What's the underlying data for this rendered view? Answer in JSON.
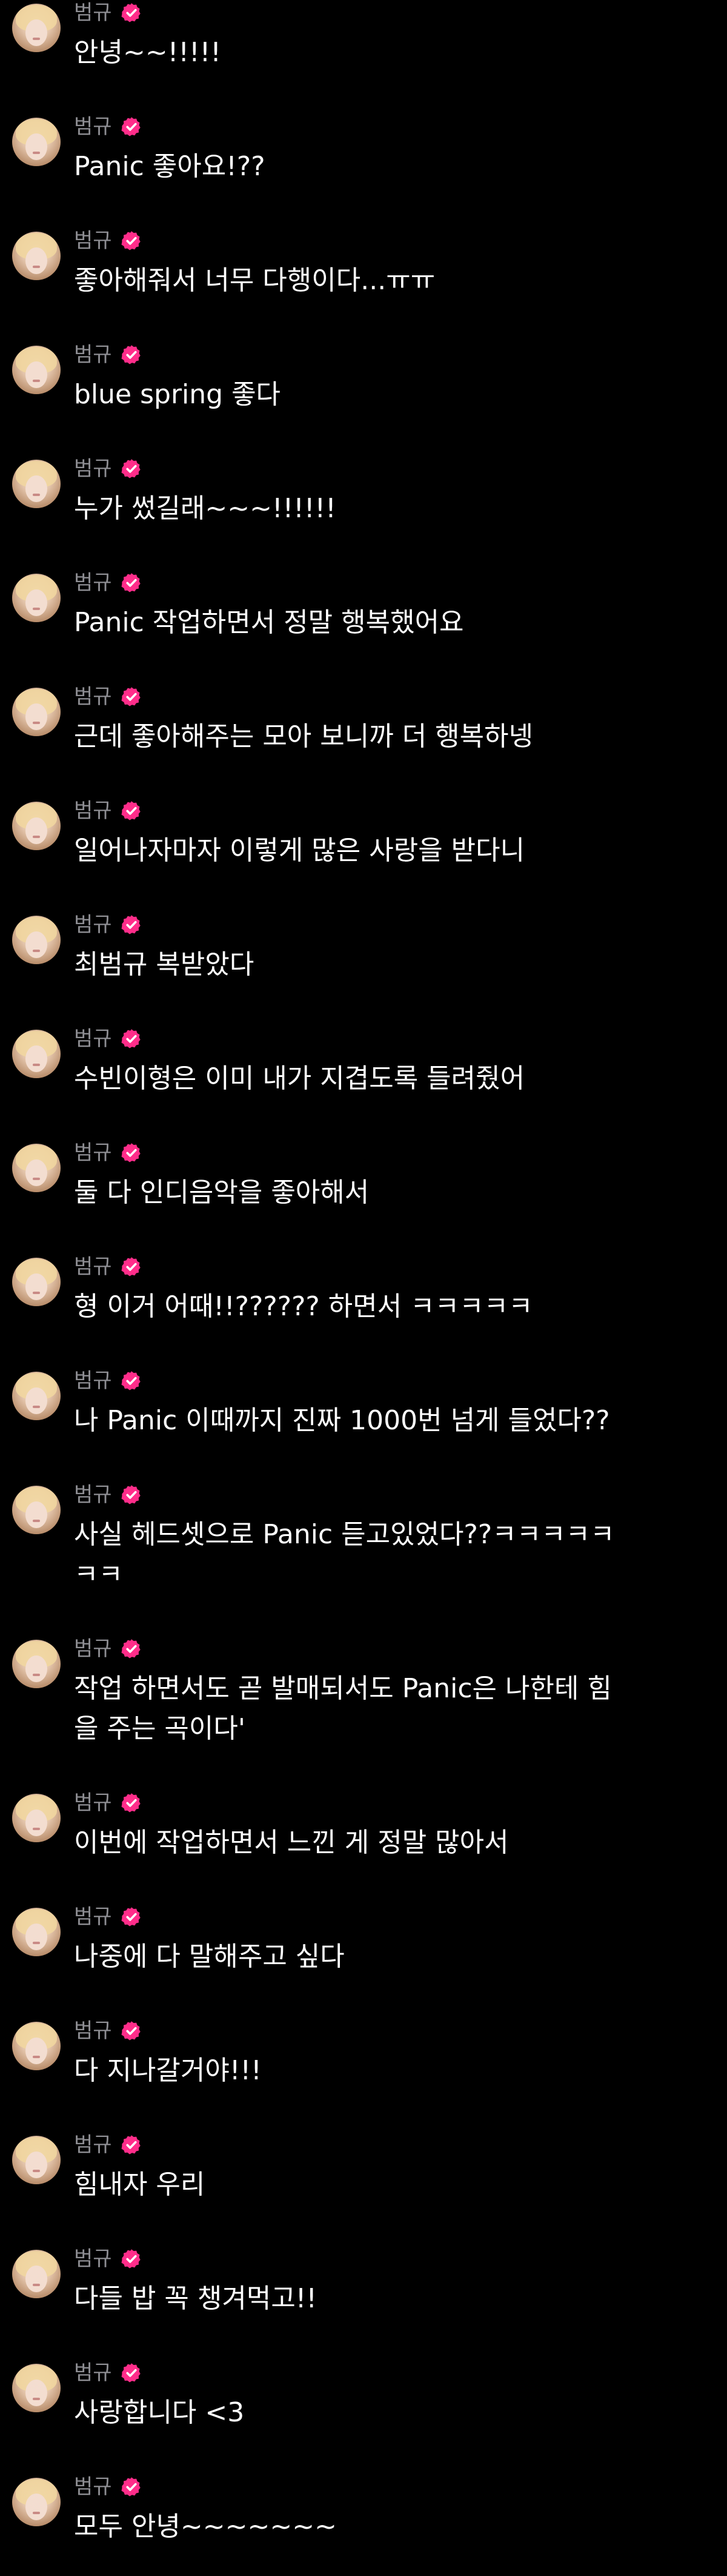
{
  "sender": {
    "name": "범규",
    "verified_badge_color": "#ff2d8a",
    "avatar_icon": "profile-photo"
  },
  "colors": {
    "background": "#000000",
    "name_text": "#8e8e93",
    "message_text": "#ffffff"
  },
  "messages": [
    {
      "text": "안녕~~!!!!!"
    },
    {
      "text": "Panic 좋아요!??"
    },
    {
      "text": "좋아해줘서 너무 다행이다...ㅠㅠ"
    },
    {
      "text": "blue spring 좋다"
    },
    {
      "text": "누가 썼길래~~~!!!!!!"
    },
    {
      "text": "Panic 작업하면서 정말 행복했어요"
    },
    {
      "text": "근데 좋아해주는 모아 보니까 더 행복하넹"
    },
    {
      "text": "일어나자마자 이렇게 많은 사랑을 받다니"
    },
    {
      "text": "최범규 복받았다"
    },
    {
      "text": "수빈이형은 이미 내가 지겹도록 들려줬어"
    },
    {
      "text": "둘 다 인디음악을 좋아해서"
    },
    {
      "text": "형 이거 어때!!?????? 하면서 ㅋㅋㅋㅋㅋ"
    },
    {
      "text": "나 Panic 이때까지 진짜 1000번 넘게 들었다??"
    },
    {
      "text": "사실 헤드셋으로 Panic 듣고있었다??ㅋㅋㅋㅋㅋ\nㅋㅋ"
    },
    {
      "text": "작업 하면서도 곧 발매되서도 Panic은 나한테 힘\n을 주는 곡이다'"
    },
    {
      "text": "이번에 작업하면서 느낀 게 정말 많아서"
    },
    {
      "text": "나중에 다 말해주고 싶다"
    },
    {
      "text": "다 지나갈거야!!!"
    },
    {
      "text": "힘내자 우리"
    },
    {
      "text": "다들 밥 꼭 챙겨먹고!!"
    },
    {
      "text": "사랑합니다 <3"
    },
    {
      "text": "모두 안녕~~~~~~~"
    }
  ]
}
